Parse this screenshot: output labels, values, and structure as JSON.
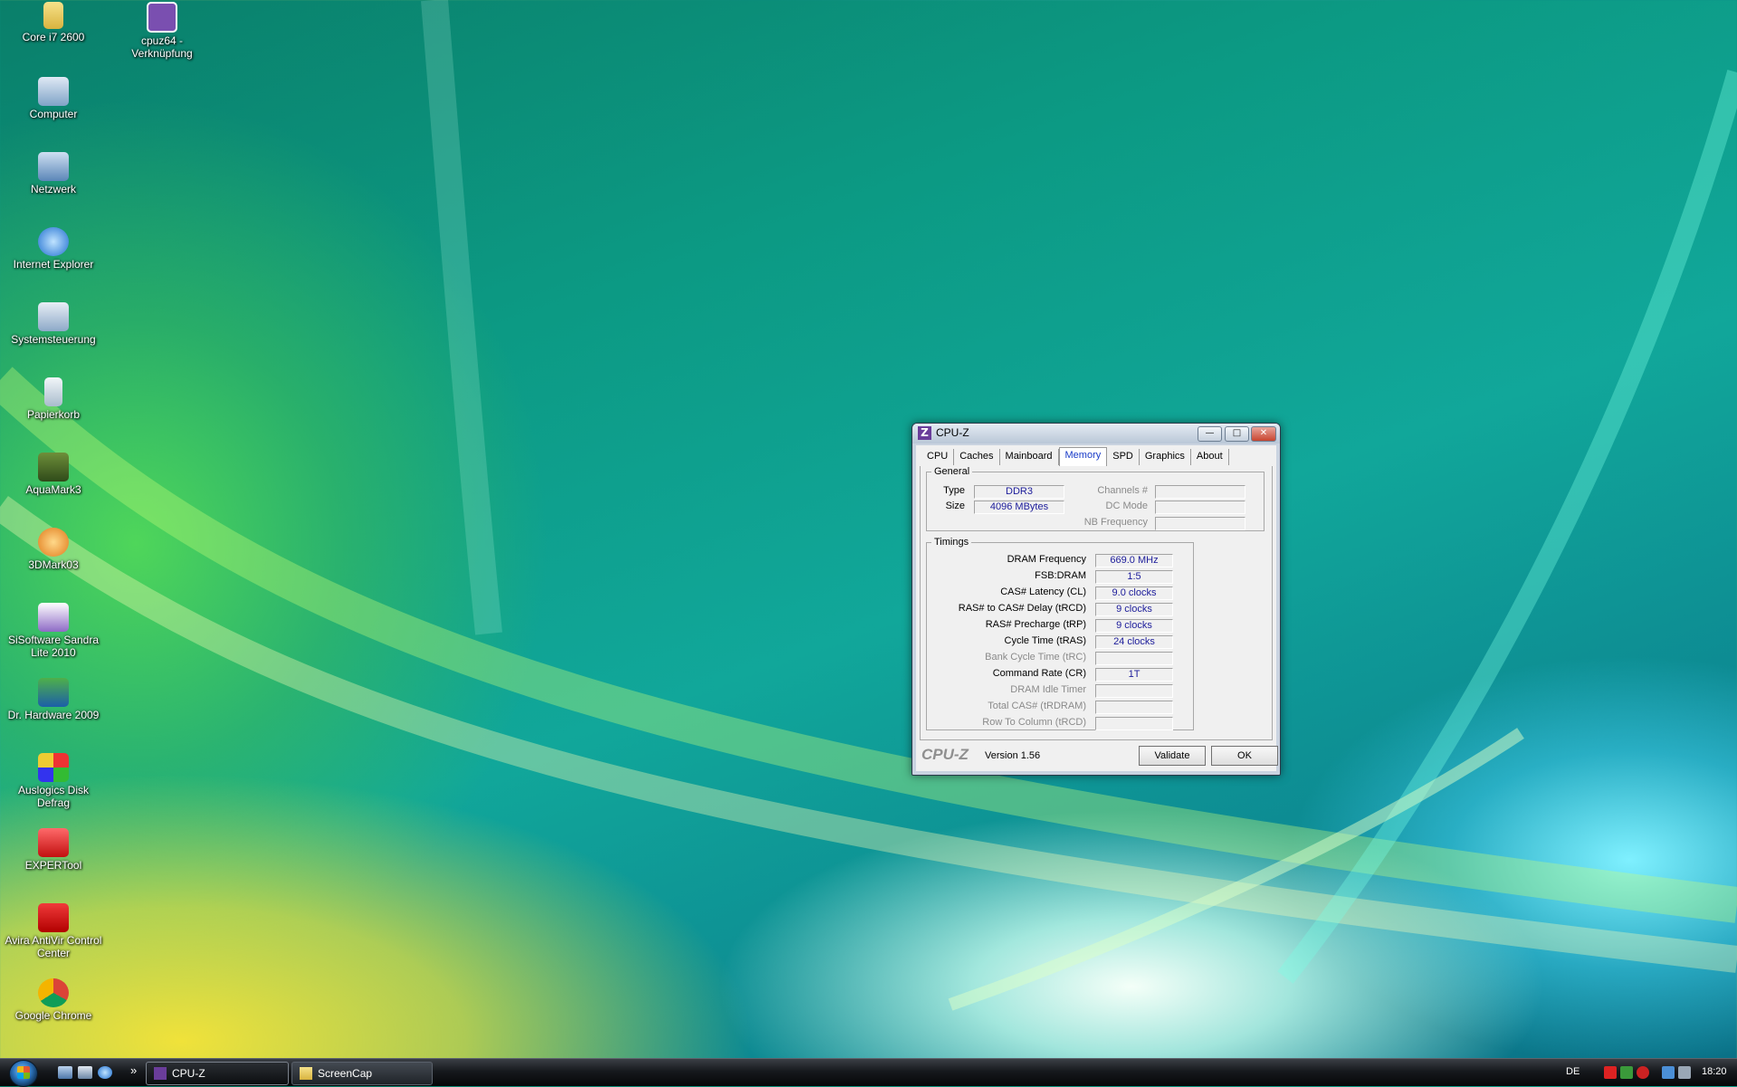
{
  "desktop": {
    "icons": [
      {
        "label": "Core i7 2600",
        "icon": "folder-icon"
      },
      {
        "label": "cpuz64 - Verknüpfung",
        "icon": "cpuz-shortcut-icon"
      },
      {
        "label": "Computer",
        "icon": "computer-icon"
      },
      {
        "label": "Netzwerk",
        "icon": "network-icon"
      },
      {
        "label": "Internet Explorer",
        "icon": "internet-explorer-icon"
      },
      {
        "label": "Systemsteuerung",
        "icon": "control-panel-icon"
      },
      {
        "label": "Papierkorb",
        "icon": "recycle-bin-icon"
      },
      {
        "label": "AquaMark3",
        "icon": "aquamark-icon"
      },
      {
        "label": "3DMark03",
        "icon": "3dmark-icon"
      },
      {
        "label": "SiSoftware Sandra Lite 2010",
        "icon": "sandra-icon"
      },
      {
        "label": "Dr. Hardware 2009",
        "icon": "dr-hardware-icon"
      },
      {
        "label": "Auslogics Disk Defrag",
        "icon": "disk-defrag-icon"
      },
      {
        "label": "EXPERTool",
        "icon": "expertool-icon"
      },
      {
        "label": "Avira AntiVir Control Center",
        "icon": "avira-icon"
      },
      {
        "label": "Google Chrome",
        "icon": "chrome-icon"
      }
    ]
  },
  "window": {
    "title": "CPU-Z",
    "app_icon_letter": "Z",
    "buttons": {
      "minimize": "—",
      "maximize": "□",
      "close": "✕"
    },
    "tabs": [
      "CPU",
      "Caches",
      "Mainboard",
      "Memory",
      "SPD",
      "Graphics",
      "About"
    ],
    "active_tab": "Memory",
    "general": {
      "legend": "General",
      "type_label": "Type",
      "type_value": "DDR3",
      "size_label": "Size",
      "size_value": "4096 MBytes",
      "channels_label": "Channels #",
      "channels_value": "",
      "dcmode_label": "DC Mode",
      "dcmode_value": "",
      "nbfreq_label": "NB Frequency",
      "nbfreq_value": ""
    },
    "timings": {
      "legend": "Timings",
      "rows": [
        {
          "label": "DRAM Frequency",
          "value": "669.0 MHz",
          "enabled": true
        },
        {
          "label": "FSB:DRAM",
          "value": "1:5",
          "enabled": true
        },
        {
          "label": "CAS# Latency (CL)",
          "value": "9.0 clocks",
          "enabled": true
        },
        {
          "label": "RAS# to CAS# Delay (tRCD)",
          "value": "9 clocks",
          "enabled": true
        },
        {
          "label": "RAS# Precharge (tRP)",
          "value": "9 clocks",
          "enabled": true
        },
        {
          "label": "Cycle Time (tRAS)",
          "value": "24 clocks",
          "enabled": true
        },
        {
          "label": "Bank Cycle Time (tRC)",
          "value": "",
          "enabled": false
        },
        {
          "label": "Command Rate (CR)",
          "value": "1T",
          "enabled": true
        },
        {
          "label": "DRAM Idle Timer",
          "value": "",
          "enabled": false
        },
        {
          "label": "Total CAS# (tRDRAM)",
          "value": "",
          "enabled": false
        },
        {
          "label": "Row To Column (tRCD)",
          "value": "",
          "enabled": false
        }
      ]
    },
    "footer": {
      "brand": "CPU-Z",
      "version": "Version 1.56",
      "validate_label": "Validate",
      "ok_label": "OK"
    }
  },
  "taskbar": {
    "quicklaunch_more": "»",
    "tasks": [
      {
        "label": "CPU-Z",
        "icon": "cpuz-icon",
        "active": true
      },
      {
        "label": "ScreenCap",
        "icon": "folder-icon",
        "active": false
      }
    ],
    "language": "DE",
    "clock": "18:20"
  }
}
